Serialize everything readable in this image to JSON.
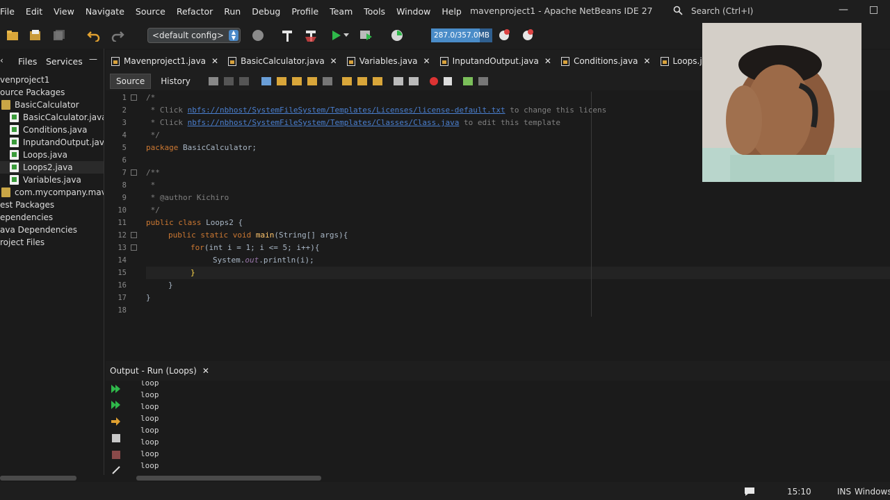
{
  "window": {
    "title": "mavenproject1 - Apache NetBeans IDE 27"
  },
  "menu": [
    "File",
    "Edit",
    "View",
    "Navigate",
    "Source",
    "Refactor",
    "Run",
    "Debug",
    "Profile",
    "Team",
    "Tools",
    "Window",
    "Help"
  ],
  "search": {
    "label": "Search (Ctrl+I)"
  },
  "toolbar": {
    "config": "<default config>",
    "memory": "287.0/357.0MB",
    "memory_fraction": 0.8
  },
  "left_panel": {
    "tabs": [
      "Files",
      "Services"
    ],
    "tree": [
      {
        "label": "venproject1",
        "type": "none"
      },
      {
        "label": "ource Packages",
        "type": "none"
      },
      {
        "label": "BasicCalculator",
        "type": "pkg"
      },
      {
        "label": "BasicCalculator.java",
        "type": "java"
      },
      {
        "label": "Conditions.java",
        "type": "java"
      },
      {
        "label": "InputandOutput.java",
        "type": "java"
      },
      {
        "label": "Loops.java",
        "type": "java"
      },
      {
        "label": "Loops2.java",
        "type": "java",
        "selected": true
      },
      {
        "label": "Variables.java",
        "type": "java"
      },
      {
        "label": "com.mycompany.maven",
        "type": "pkg"
      },
      {
        "label": "est Packages",
        "type": "none"
      },
      {
        "label": "ependencies",
        "type": "none"
      },
      {
        "label": "ava Dependencies",
        "type": "none"
      },
      {
        "label": "roject Files",
        "type": "none"
      }
    ]
  },
  "editor_tabs": [
    "Mavenproject1.java",
    "BasicCalculator.java",
    "Variables.java",
    "InputandOutput.java",
    "Conditions.java",
    "Loops.java"
  ],
  "source_bar": {
    "source": "Source",
    "history": "History"
  },
  "code": {
    "line_numbers": [
      "1",
      "2",
      "3",
      "4",
      "5",
      "6",
      "7",
      "8",
      "9",
      "10",
      "11",
      "12",
      "13",
      "14",
      "15",
      "16",
      "17",
      "18"
    ],
    "comment_prefix_2": " * Click ",
    "link_2": "nbfs://nbhost/SystemFileSystem/Templates/Licenses/license-default.txt",
    "suffix_2": " to change this licens",
    "comment_prefix_3": " * Click ",
    "link_3": "nbfs://nbhost/SystemFileSystem/Templates/Classes/Class.java",
    "suffix_3": " to edit this template",
    "line_1": "/*",
    "line_4": " */",
    "line_5_kw": "package",
    "line_5_rest": " BasicCalculator;",
    "line_7": "/**",
    "line_8": " *",
    "line_9": " * @author Kichiro",
    "line_10": " */",
    "line_11_kw": "public class",
    "line_11_rest": " Loops2 {",
    "line_12_kw1": "public",
    "line_12_kw2": "static",
    "line_12_kw3": "void",
    "line_12_fn": "main",
    "line_12_rest": "(String[] args){",
    "line_13_kw": "for",
    "line_13_rest": "(int i = 1; i <= 5; i++){",
    "line_14_a": "System.",
    "line_14_b": "out",
    "line_14_c": ".println(i);",
    "line_15": "}",
    "line_16": "}",
    "line_17": "}"
  },
  "output": {
    "tab": "Output - Run (Loops)",
    "lines": [
      "loop",
      "loop",
      "loop",
      "loop",
      "loop",
      "loop",
      "loop",
      "loop"
    ]
  },
  "status": {
    "time": "15:10",
    "mode": "INS",
    "os": "Windows"
  }
}
